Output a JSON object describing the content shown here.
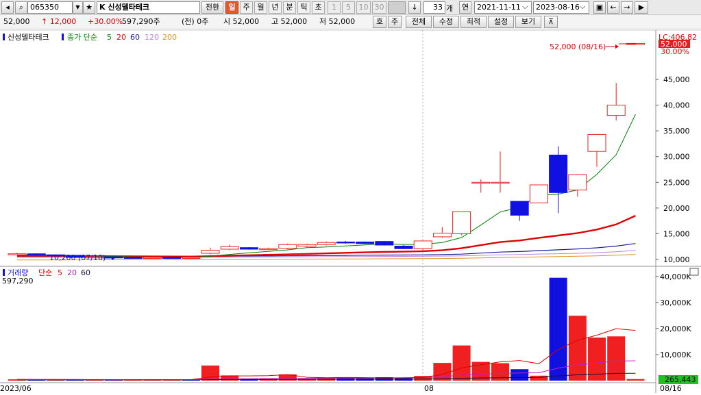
{
  "toolbar": {
    "code": "065350",
    "name": "K 신성델타테크",
    "convert_label": "전환",
    "timeframes": [
      {
        "label": "일",
        "active": true,
        "dim": false
      },
      {
        "label": "주",
        "active": false,
        "dim": false
      },
      {
        "label": "월",
        "active": false,
        "dim": false
      },
      {
        "label": "년",
        "active": false,
        "dim": false
      },
      {
        "label": "분",
        "active": false,
        "dim": false
      },
      {
        "label": "틱",
        "active": false,
        "dim": false
      },
      {
        "label": "초",
        "active": false,
        "dim": false
      },
      {
        "label": "1",
        "active": false,
        "dim": true
      },
      {
        "label": "5",
        "active": false,
        "dim": true
      },
      {
        "label": "10",
        "active": false,
        "dim": true
      },
      {
        "label": "30",
        "active": false,
        "dim": true
      }
    ],
    "count": "33",
    "count_unit": "개",
    "year_label": "연",
    "start_date": "2021-11-11",
    "end_date": "2023-08-16"
  },
  "quote": {
    "price": "52,000",
    "change": "↑ 12,000",
    "change_pct": "+30.00%",
    "volume": "597,290주",
    "prev_volume": "(전) 0주",
    "open": "시 52,000",
    "high": "고 52,000",
    "low": "저 52,000",
    "ho_label": "호",
    "ju_label": "주",
    "menu": [
      "전체",
      "수정",
      "최적",
      "설정",
      "보기"
    ]
  },
  "legend": {
    "stock_name": "신성델타테크",
    "ma_title": "종가 단순",
    "ma_periods": [
      "5",
      "20",
      "60",
      "120",
      "200"
    ],
    "volume_title": "거래량",
    "vol_ma_title": "단순",
    "vol_ma_periods": [
      "5",
      "20",
      "60"
    ]
  },
  "colors": {
    "up": "#f02020",
    "down": "#1010e0",
    "ma5": "#008000",
    "ma20": "#e00000",
    "ma60": "#1a1aa0",
    "ma120": "#c080e0",
    "ma200": "#e09020",
    "vma5": "#e00000",
    "vma20": "#c020c0",
    "vma60": "#101040"
  },
  "annotations": {
    "max_label": "52,000 (08/16)",
    "min_label": "10,200 (07/10)",
    "lc_label": "LC:406.82",
    "last_price_tag": "52,000",
    "pct_tag": "30.00%",
    "vol_current_label": "597,290",
    "vol_last_tag": "265,443",
    "date_left": "2023/06",
    "date_mid": "08",
    "date_right": "08/16"
  },
  "chart_data": [
    {
      "type": "candlestick",
      "ylim": [
        9500,
        52000
      ],
      "yticks": [
        10000,
        15000,
        20000,
        25000,
        30000,
        35000,
        40000,
        45000
      ],
      "ytick_labels": [
        "10,000",
        "15,000",
        "20,000",
        "25,000",
        "30,000",
        "35,000",
        "40,000",
        "45,000"
      ],
      "candles": [
        [
          11000,
          11300,
          10800,
          11100
        ],
        [
          11100,
          11200,
          10700,
          10900
        ],
        [
          10900,
          11000,
          10600,
          10800
        ],
        [
          10800,
          10900,
          10300,
          10400
        ],
        [
          10400,
          10600,
          10200,
          10500
        ],
        [
          10500,
          10700,
          10300,
          10400
        ],
        [
          10400,
          10500,
          10200,
          10300
        ],
        [
          10300,
          10500,
          10200,
          10400
        ],
        [
          10400,
          10500,
          10200,
          10300
        ],
        [
          10300,
          10500,
          10200,
          10400
        ],
        [
          11200,
          12300,
          11000,
          11800
        ],
        [
          12000,
          12900,
          11800,
          12500
        ],
        [
          12300,
          12400,
          11900,
          12000
        ],
        [
          11900,
          12300,
          11800,
          12100
        ],
        [
          12200,
          13100,
          12000,
          12900
        ],
        [
          12600,
          13100,
          12400,
          12900
        ],
        [
          12900,
          13500,
          12700,
          13300
        ],
        [
          13400,
          13600,
          13100,
          13300
        ],
        [
          13400,
          13500,
          13000,
          13100
        ],
        [
          13500,
          13600,
          12700,
          12800
        ],
        [
          12600,
          12800,
          12000,
          12100
        ],
        [
          12100,
          13700,
          11900,
          13600
        ],
        [
          14400,
          16300,
          14200,
          15100
        ],
        [
          15000,
          19300,
          14700,
          19300
        ],
        [
          25000,
          25600,
          23000,
          25000
        ],
        [
          25000,
          31000,
          23000,
          25000
        ],
        [
          21300,
          21300,
          17500,
          18600
        ],
        [
          21000,
          24500,
          20900,
          24500
        ],
        [
          30300,
          32000,
          19000,
          23000
        ],
        [
          23500,
          26600,
          22200,
          26500
        ],
        [
          31000,
          34300,
          28000,
          34300
        ],
        [
          38000,
          44300,
          37000,
          40000
        ],
        [
          52000,
          52000,
          52000,
          52000
        ]
      ],
      "ma5": [
        10900,
        10880,
        10860,
        10780,
        10700,
        10600,
        10480,
        10420,
        10380,
        10360,
        10640,
        10980,
        11300,
        11560,
        11860,
        12290,
        12440,
        12620,
        12840,
        13040,
        12920,
        12940,
        13300,
        14260,
        16700,
        19240,
        20140,
        22480,
        22700,
        23520,
        26560,
        30360,
        38200
      ],
      "ma20": [
        10700,
        10700,
        10690,
        10670,
        10650,
        10630,
        10610,
        10590,
        10570,
        10560,
        10640,
        10730,
        10820,
        10900,
        10990,
        11080,
        11180,
        11290,
        11390,
        11470,
        11520,
        11610,
        11780,
        12180,
        12780,
        13380,
        13690,
        14200,
        14660,
        15120,
        15820,
        16820,
        18500
      ],
      "ma60": [
        10600,
        10600,
        10600,
        10600,
        10600,
        10600,
        10600,
        10600,
        10600,
        10600,
        10620,
        10640,
        10660,
        10680,
        10700,
        10730,
        10760,
        10790,
        10820,
        10850,
        10860,
        10890,
        10940,
        11040,
        11240,
        11440,
        11540,
        11720,
        11880,
        12040,
        12260,
        12600,
        13100
      ],
      "ma120": [
        10400,
        10400,
        10400,
        10410,
        10410,
        10410,
        10420,
        10420,
        10420,
        10430,
        10440,
        10460,
        10470,
        10480,
        10500,
        10520,
        10540,
        10560,
        10570,
        10590,
        10600,
        10620,
        10650,
        10710,
        10800,
        10900,
        10960,
        11050,
        11120,
        11200,
        11320,
        11500,
        11760
      ],
      "ma200": [
        9900,
        9900,
        9910,
        9920,
        9930,
        9940,
        9950,
        9960,
        9970,
        9980,
        9990,
        10000,
        10010,
        10020,
        10040,
        10060,
        10080,
        10100,
        10110,
        10130,
        10140,
        10160,
        10190,
        10240,
        10300,
        10380,
        10430,
        10500,
        10560,
        10620,
        10700,
        10820,
        10980
      ]
    },
    {
      "type": "bar",
      "ylim": [
        0,
        41000
      ],
      "yticks": [
        10000,
        20000,
        30000,
        40000
      ],
      "ytick_labels": [
        "10,000K",
        "20,000K",
        "30,000K",
        "40,000K"
      ],
      "unit": "K",
      "values": [
        500,
        400,
        350,
        300,
        350,
        300,
        400,
        500,
        350,
        400,
        5800,
        2000,
        600,
        800,
        2400,
        700,
        1200,
        1000,
        900,
        1300,
        1000,
        1800,
        6800,
        13500,
        7200,
        6700,
        4400,
        1900,
        39500,
        24900,
        16500,
        17000,
        600
      ],
      "ups": [
        true,
        false,
        true,
        false,
        true,
        false,
        true,
        true,
        true,
        false,
        true,
        true,
        false,
        true,
        true,
        true,
        true,
        false,
        false,
        false,
        false,
        true,
        true,
        true,
        true,
        true,
        false,
        true,
        false,
        true,
        true,
        true,
        true
      ],
      "vma5": [
        500,
        480,
        460,
        440,
        380,
        340,
        340,
        360,
        380,
        390,
        1390,
        1810,
        1810,
        1920,
        2320,
        1300,
        1140,
        1220,
        1160,
        1020,
        1080,
        1200,
        2360,
        4880,
        6060,
        7200,
        7720,
        6500,
        11940,
        15480,
        17440,
        19960,
        19300
      ],
      "vma20": [
        400,
        400,
        400,
        400,
        400,
        400,
        400,
        400,
        400,
        400,
        660,
        740,
        760,
        780,
        880,
        900,
        940,
        980,
        1010,
        1050,
        1080,
        1160,
        1470,
        2120,
        2440,
        2760,
        2950,
        3010,
        4840,
        6010,
        6780,
        7580,
        7600
      ],
      "vma60": [
        300,
        300,
        300,
        300,
        300,
        300,
        300,
        300,
        300,
        300,
        390,
        420,
        430,
        440,
        480,
        490,
        500,
        520,
        530,
        540,
        550,
        580,
        690,
        910,
        1020,
        1130,
        1190,
        1220,
        1830,
        2240,
        2500,
        2780,
        2800
      ]
    }
  ]
}
